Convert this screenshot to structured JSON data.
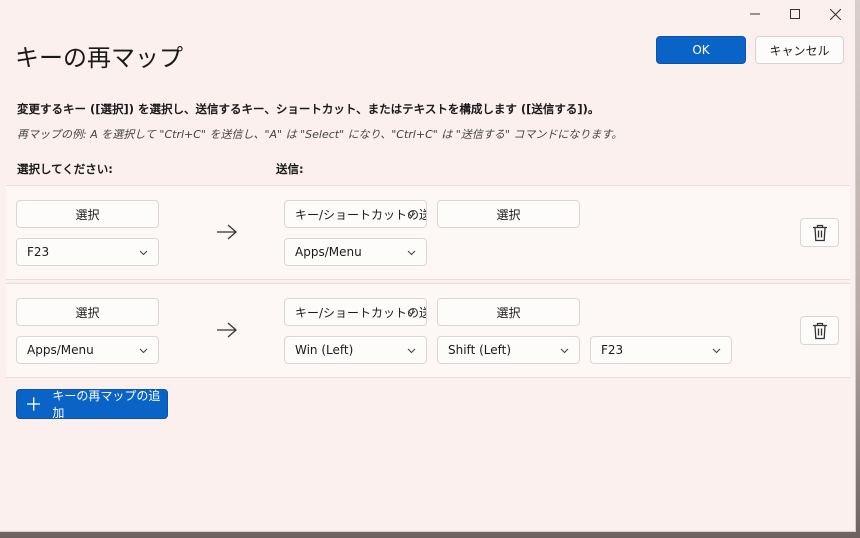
{
  "window": {
    "title": "キーの再マップ",
    "ok_label": "OK",
    "cancel_label": "キャンセル"
  },
  "description": "変更するキー ([選択]) を選択し、送信するキー、ショートカット、またはテキストを構成します ([送信する])。",
  "example": "再マップの例: A を選択して \"Ctrl+C\" を送信し、\"A\" は \"Select\" になり、\"Ctrl+C\" は \"送信する\" コマンドになります。",
  "columns": {
    "original": "選択してください:",
    "send": "送信:"
  },
  "rows": [
    {
      "select_label": "選択",
      "original_key": "F23",
      "type": "キー/ショートカットの送信",
      "send_select_label": "選択",
      "send_keys": [
        "Apps/Menu"
      ]
    },
    {
      "select_label": "選択",
      "original_key": "Apps/Menu",
      "type": "キー/ショートカットの送信",
      "send_select_label": "選択",
      "send_keys": [
        "Win (Left)",
        "Shift (Left)",
        "F23"
      ]
    }
  ],
  "add_button_label": "キーの再マップの追加",
  "colors": {
    "accent": "#0a64c8",
    "background": "#fbf0ee"
  }
}
